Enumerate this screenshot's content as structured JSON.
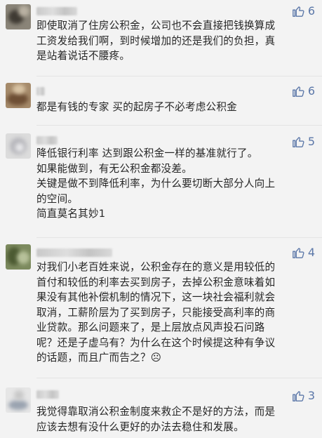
{
  "comments": [
    {
      "likes": "6",
      "lines": [
        "即使取消了住房公积金，公司也不会直接把钱换算成",
        "工资发给我们啊，到时候增加的还是我们的负担，真",
        "是站着说话不腰疼。"
      ]
    },
    {
      "likes": "6",
      "lines": [
        "都是有钱的专家 买的起房子不必考虑公积金"
      ]
    },
    {
      "likes": "5",
      "lines": [
        "降低银行利率 达到跟公积金一样的基准就行了。",
        "如果能做到，有无公积金都没差。",
        "关键是做不到降低利率，为什么要切断大部分人向上",
        "的空间。",
        "简直莫名其妙1"
      ]
    },
    {
      "likes": "4",
      "lines": [
        "对我们小老百姓来说，公积金存在的意义是用较低的",
        "首付和较低的利率去买到房子，去掉公积金意味着如",
        "果没有其他补偿机制的情况下，这一块社会福利就会",
        "取消，工薪阶层为了买到房子，只能接受高利率的商",
        "业贷款。那么问题来了，是上层放点风声投石问路",
        "呢？还是子虚乌有？为什么在这个时候提这种有争议",
        "的话题，而且广而告之？☹"
      ]
    },
    {
      "likes": "3",
      "lines": [
        "我觉得靠取消公积金制度来救企不是好的方法，而是",
        "应该去想有没什么更好的办法去稳住和发展。"
      ]
    }
  ],
  "colors": {
    "background": "#f3f3f3",
    "like": "#5b77a8",
    "text": "#262626"
  },
  "icons": {
    "like": "thumbs-up-icon"
  }
}
